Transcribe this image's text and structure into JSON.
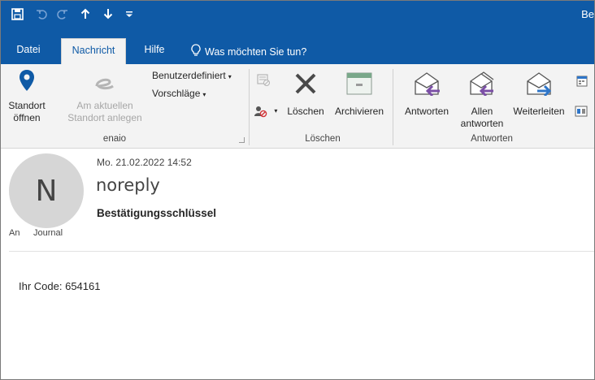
{
  "titlebar": {
    "title": "Be",
    "qat": [
      {
        "icon": "save-icon"
      },
      {
        "icon": "undo-icon"
      },
      {
        "icon": "redo-icon"
      },
      {
        "icon": "arrow-up-icon"
      },
      {
        "icon": "arrow-down-icon"
      },
      {
        "icon": "customize-qat-icon"
      }
    ]
  },
  "tabs": {
    "datei": "Datei",
    "nachricht": "Nachricht",
    "hilfe": "Hilfe",
    "tellme": "Was möchten Sie tun?"
  },
  "ribbon": {
    "enaio": {
      "label": "enaio",
      "standort_oeffnen_1": "Standort",
      "standort_oeffnen_2": "öffnen",
      "standort_anlegen_1": "Am aktuellen",
      "standort_anlegen_2": "Standort anlegen",
      "benutzerdefiniert": "Benutzerdefiniert",
      "vorschlaege": "Vorschläge"
    },
    "loeschen": {
      "label": "Löschen",
      "loeschen": "Löschen",
      "archivieren": "Archivieren"
    },
    "antworten": {
      "label": "Antworten",
      "antworten": "Antworten",
      "allen_1": "Allen",
      "allen_2": "antworten",
      "weiterleiten": "Weiterleiten"
    }
  },
  "message": {
    "avatar_initial": "N",
    "date": "Mo. 21.02.2022 14:52",
    "sender": "noreply",
    "subject": "Bestätigungsschlüssel",
    "to_label": "An",
    "to_value": "Journal",
    "body": "Ihr Code: 654161"
  },
  "colors": {
    "accent": "#0f5aa6",
    "ribbon_bg": "#f3f3f3",
    "avatar_bg": "#d6d6d6",
    "reply_arrow": "#7b4fa6",
    "forward_arrow": "#2e75c8"
  }
}
